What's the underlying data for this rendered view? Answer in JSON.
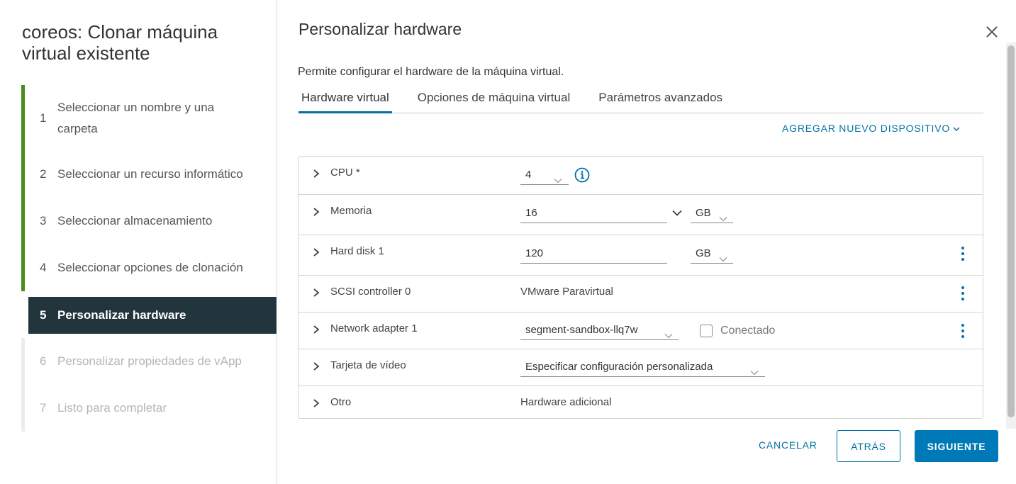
{
  "wizard": {
    "title": "coreos: Clonar máquina virtual existente",
    "steps": [
      {
        "num": "1",
        "label": "Seleccionar un nombre y una carpeta",
        "state": "done"
      },
      {
        "num": "2",
        "label": "Seleccionar un recurso informático",
        "state": "done"
      },
      {
        "num": "3",
        "label": "Seleccionar almacenamiento",
        "state": "done"
      },
      {
        "num": "4",
        "label": "Seleccionar opciones de clonación",
        "state": "done"
      },
      {
        "num": "5",
        "label": "Personalizar hardware",
        "state": "active"
      },
      {
        "num": "6",
        "label": "Personalizar propiedades de vApp",
        "state": "disabled"
      },
      {
        "num": "7",
        "label": "Listo para completar",
        "state": "disabled"
      }
    ]
  },
  "main": {
    "title": "Personalizar hardware",
    "subtitle": "Permite configurar el hardware de la máquina virtual.",
    "tabs": [
      {
        "label": "Hardware virtual",
        "active": true
      },
      {
        "label": "Opciones de máquina virtual",
        "active": false
      },
      {
        "label": "Parámetros avanzados",
        "active": false
      }
    ],
    "add_device_label": "AGREGAR NUEVO DISPOSITIVO"
  },
  "hardware": {
    "cpu": {
      "label": "CPU *",
      "value": "4"
    },
    "memory": {
      "label": "Memoria",
      "value": "16",
      "unit": "GB"
    },
    "hard_disk": {
      "label": "Hard disk 1",
      "value": "120",
      "unit": "GB"
    },
    "scsi": {
      "label": "SCSI controller 0",
      "value": "VMware Paravirtual"
    },
    "network": {
      "label": "Network adapter 1",
      "value": "segment-sandbox-llq7w",
      "connected_label": "Conectado"
    },
    "video": {
      "label": "Tarjeta de vídeo",
      "value": "Especificar configuración personalizada"
    },
    "other": {
      "label": "Otro",
      "value": "Hardware adicional"
    }
  },
  "footer": {
    "cancel": "CANCELAR",
    "back": "ATRÁS",
    "next": "SIGUIENTE"
  },
  "colors": {
    "accent": "#0072a3",
    "primary_button": "#0079b8",
    "step_done": "#4c8c1f",
    "step_active_bg": "#22343c"
  },
  "icons": [
    "close-icon",
    "chevron-right-icon",
    "chevron-down-icon",
    "info-icon",
    "kebab-menu-icon"
  ]
}
